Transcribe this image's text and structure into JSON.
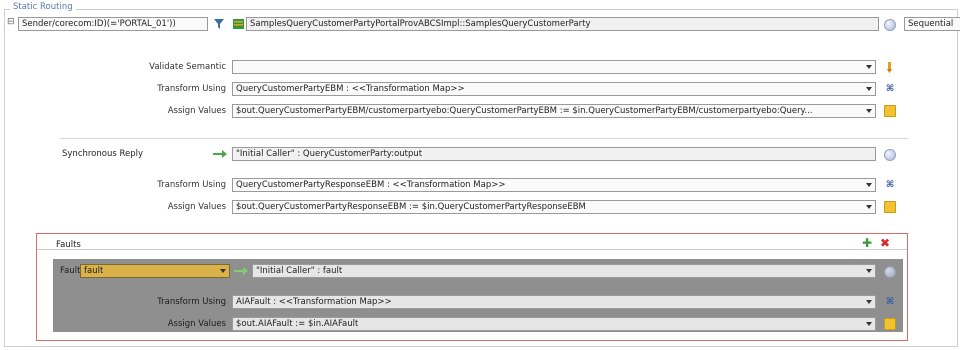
{
  "section": {
    "legend": "Static Routing"
  },
  "route": {
    "toggle": "⊟",
    "condition": "Sender/corecom:ID)(='PORTAL_01'))",
    "target": "SamplesQueryCustomerPartyPortalProvABCSImpl::SamplesQueryCustomerParty",
    "mode": "Sequential"
  },
  "request": {
    "validate_label": "Validate Semantic",
    "validate_value": "",
    "transform_label": "Transform Using",
    "transform_value": "QueryCustomerPartyEBM : <<Transformation Map>>",
    "assign_label": "Assign Values",
    "assign_value": "$out.QueryCustomerPartyEBM/customerpartyebo:QueryCustomerPartyEBM := $in.QueryCustomerPartyEBM/customerpartyebo:Query..."
  },
  "reply": {
    "label": "Synchronous Reply",
    "target": "\"Initial Caller\" : QueryCustomerParty:output",
    "transform_label": "Transform Using",
    "transform_value": "QueryCustomerPartyResponseEBM : <<Transformation Map>>",
    "assign_label": "Assign Values",
    "assign_value": "$out.QueryCustomerPartyResponseEBM := $in.QueryCustomerPartyResponseEBM"
  },
  "faults": {
    "title": "Faults",
    "add_icon": "✚",
    "delete_icon": "✖",
    "fault_label": "Fault",
    "fault_value": "fault",
    "target": "\"Initial Caller\" : fault",
    "transform_label": "Transform Using",
    "transform_value": "AIAFault : <<Transformation Map>>",
    "assign_label": "Assign Values",
    "assign_value": "$out.AIAFault := $in.AIAFault"
  }
}
